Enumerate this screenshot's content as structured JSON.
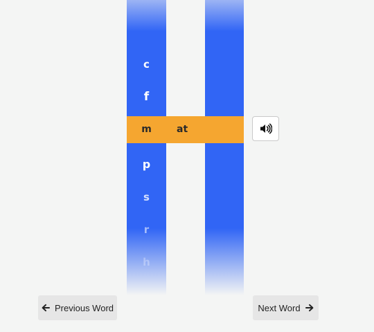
{
  "reel": {
    "letters": [
      "c",
      "f",
      "p",
      "s",
      "r",
      "h"
    ],
    "selected_letter": "m",
    "rime": "at"
  },
  "buttons": {
    "previous_label": "Previous Word",
    "next_label": "Next Word"
  },
  "icons": {
    "sound": "speaker-volume-icon",
    "previous": "arrow-left-icon",
    "next": "arrow-right-icon"
  },
  "colors": {
    "reel": "#3165f5",
    "band": "#f5a630",
    "button_bg": "#e6e6e6"
  }
}
